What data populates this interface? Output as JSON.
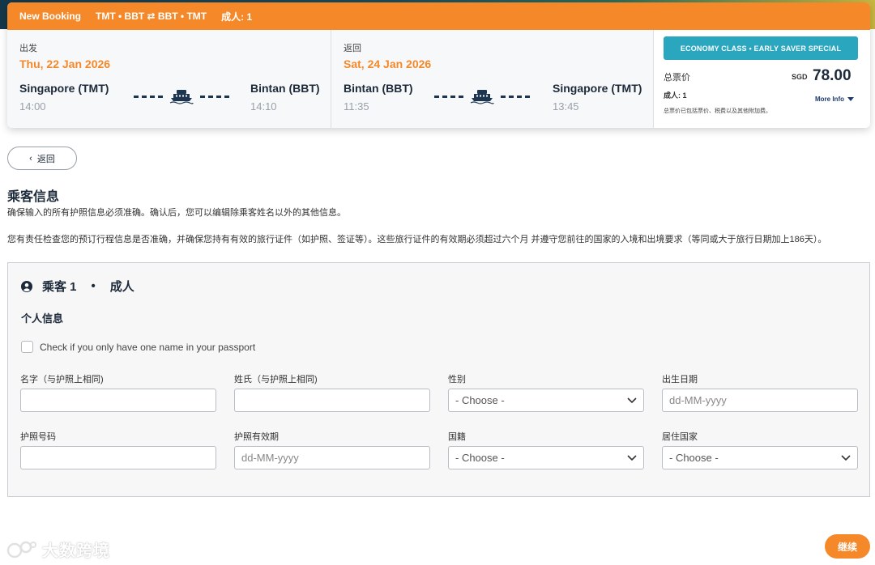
{
  "header": {
    "title": "New Booking",
    "route": "TMT • BBT ⇄ BBT • TMT",
    "passengers": "成人: 1"
  },
  "outbound": {
    "label": "出发",
    "date": "Thu, 22 Jan 2026",
    "from_station": "Singapore (TMT)",
    "from_time": "14:00",
    "to_station": "Bintan (BBT)",
    "to_time": "14:10"
  },
  "return": {
    "label": "返回",
    "date": "Sat, 24 Jan 2026",
    "from_station": "Bintan (BBT)",
    "from_time": "11:35",
    "to_station": "Singapore (TMT)",
    "to_time": "13:45"
  },
  "fare": {
    "badge": "ECONOMY CLASS • EARLY SAVER SPECIAL",
    "total_label": "总票价",
    "currency": "SGD",
    "amount": "78.00",
    "adult": "成人:   1",
    "more_info": "More Info",
    "note": "总票价已包括票价、税费以及其他附加费。"
  },
  "nav": {
    "back": "返回",
    "continue": "继续"
  },
  "page": {
    "title": "乘客信息",
    "notice1": "确保输入的所有护照信息必须准确。确认后，您可以编辑除乘客姓名以外的其他信息。",
    "notice2": "您有责任检查您的预订行程信息是否准确，并确保您持有有效的旅行证件（如护照、签证等）。这些旅行证件的有效期必须超过六个月 并遵守您前往的国家的入境和出境要求（等同或大于旅行日期加上186天）。"
  },
  "passenger": {
    "label": "乘客 1",
    "type": "成人",
    "section": "个人信息",
    "single_name": "Check if you only have one name in your passport",
    "fields": {
      "first_name": {
        "label": "名字（与护照上相同)",
        "value": ""
      },
      "last_name": {
        "label": "姓氏（与护照上相同)",
        "value": ""
      },
      "gender": {
        "label": "性别",
        "value": "- Choose -"
      },
      "dob": {
        "label": "出生日期",
        "placeholder": "dd-MM-yyyy"
      },
      "passport_no": {
        "label": "护照号码",
        "value": ""
      },
      "passport_expiry": {
        "label": "护照有效期",
        "placeholder": "dd-MM-yyyy"
      },
      "nationality": {
        "label": "国籍",
        "value": "- Choose -"
      },
      "residence": {
        "label": "居住国家",
        "value": "- Choose -"
      }
    }
  },
  "watermark": "大数跨境",
  "colors": {
    "accent": "#f5892a",
    "badge": "#2aa6bf",
    "text": "#1d2a3a"
  }
}
